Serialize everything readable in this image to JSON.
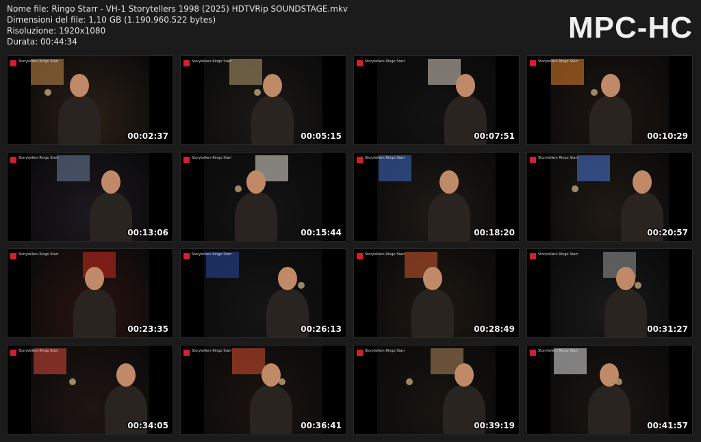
{
  "header": {
    "file_name": "Nome file: Ringo Starr - VH-1 Storytellers 1998 (2025) HDTVRip SOUNDSTAGE.mkv",
    "file_size": "Dimensioni del file: 1,10 GB (1.190.960.522 bytes)",
    "resolution": "Risoluzione: 1920x1080",
    "duration": "Durata: 00:44:34"
  },
  "brand": "MPC-HC",
  "channel_logo_text": "Storytellers  Ringo Starr",
  "thumbnails": [
    {
      "time": "00:02:37",
      "bg": "#2b2016",
      "accent": "#c58a4a"
    },
    {
      "time": "00:05:15",
      "bg": "#1c1a18",
      "accent": "#b49a70"
    },
    {
      "time": "00:07:51",
      "bg": "#121212",
      "accent": "#d8cfc2"
    },
    {
      "time": "00:10:29",
      "bg": "#1e1610",
      "accent": "#e0822a"
    },
    {
      "time": "00:13:06",
      "bg": "#1d1820",
      "accent": "#6f7fa0"
    },
    {
      "time": "00:15:44",
      "bg": "#141414",
      "accent": "#e8e2d8"
    },
    {
      "time": "00:18:20",
      "bg": "#1f1a15",
      "accent": "#3f6ec8"
    },
    {
      "time": "00:20:57",
      "bg": "#201a14",
      "accent": "#4a78d8"
    },
    {
      "time": "00:23:35",
      "bg": "#2a1410",
      "accent": "#d02a22"
    },
    {
      "time": "00:26:13",
      "bg": "#151515",
      "accent": "#2a4aa0"
    },
    {
      "time": "00:28:49",
      "bg": "#1f1812",
      "accent": "#d05a30"
    },
    {
      "time": "00:31:27",
      "bg": "#1a1a1a",
      "accent": "#9a9a9a"
    },
    {
      "time": "00:34:05",
      "bg": "#1f1512",
      "accent": "#d84a3a"
    },
    {
      "time": "00:36:41",
      "bg": "#1c1410",
      "accent": "#d8502e"
    },
    {
      "time": "00:39:19",
      "bg": "#181410",
      "accent": "#b08a60"
    },
    {
      "time": "00:41:57",
      "bg": "#1b1612",
      "accent": "#e0e0e0"
    }
  ]
}
